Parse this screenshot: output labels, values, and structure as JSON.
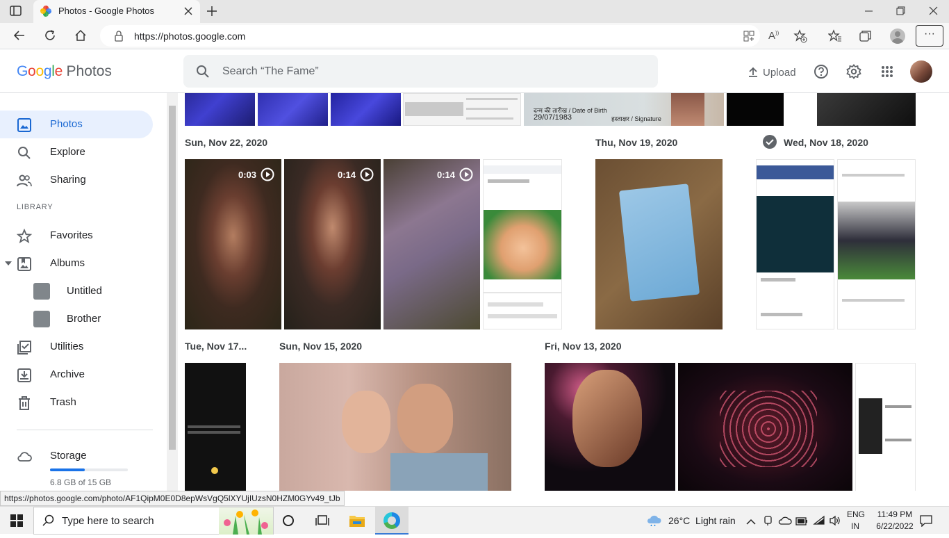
{
  "browser": {
    "tab_title": "Photos - Google Photos",
    "url": "https://photos.google.com",
    "status_link": "https://photos.google.com/photo/AF1QipM0E0D8epWsVgQ5lXYUjIUzsN0HZM0GYv49_tJb"
  },
  "app": {
    "logo_google": "Google",
    "logo_photos": "Photos",
    "search_placeholder": "Search “The Fame”",
    "upload_label": "Upload",
    "colors": {
      "blue": "#4285f4",
      "red": "#ea4335",
      "yellow": "#fbbc05",
      "green": "#34a853",
      "active_text": "#1967d2",
      "active_bg": "#e8f0fe"
    }
  },
  "sidebar": {
    "items": [
      {
        "label": "Photos",
        "icon": "photo-icon"
      },
      {
        "label": "Explore",
        "icon": "search-icon"
      },
      {
        "label": "Sharing",
        "icon": "people-icon"
      }
    ],
    "library_header": "LIBRARY",
    "library": [
      {
        "label": "Favorites",
        "icon": "star-icon"
      },
      {
        "label": "Albums",
        "icon": "album-icon"
      },
      {
        "label": "Untitled",
        "icon": "album-thumb"
      },
      {
        "label": "Brother",
        "icon": "album-thumb"
      },
      {
        "label": "Utilities",
        "icon": "checklist-icon"
      },
      {
        "label": "Archive",
        "icon": "archive-icon"
      },
      {
        "label": "Trash",
        "icon": "trash-icon"
      }
    ],
    "storage_label": "Storage",
    "storage_text": "6.8 GB of 15 GB",
    "storage_fraction": 0.45
  },
  "content": {
    "dates": [
      "Sun, Nov 22, 2020",
      "Thu, Nov 19, 2020",
      "Wed, Nov 18, 2020",
      "Tue, Nov 17...",
      "Sun, Nov 15, 2020",
      "Fri, Nov 13, 2020"
    ],
    "videos": [
      "0:03",
      "0:14",
      "0:14"
    ],
    "id_card_text": "दन्म की तारीख / Date of Birth",
    "id_dob": "29/07/1983",
    "id_signature": "हस्ताक्षर / Signature"
  },
  "taskbar": {
    "search_placeholder": "Type here to search",
    "weather": "26°C  Light rain",
    "lang_top": "ENG",
    "lang_bottom": "IN",
    "time": "11:49 PM",
    "date": "6/22/2022"
  }
}
